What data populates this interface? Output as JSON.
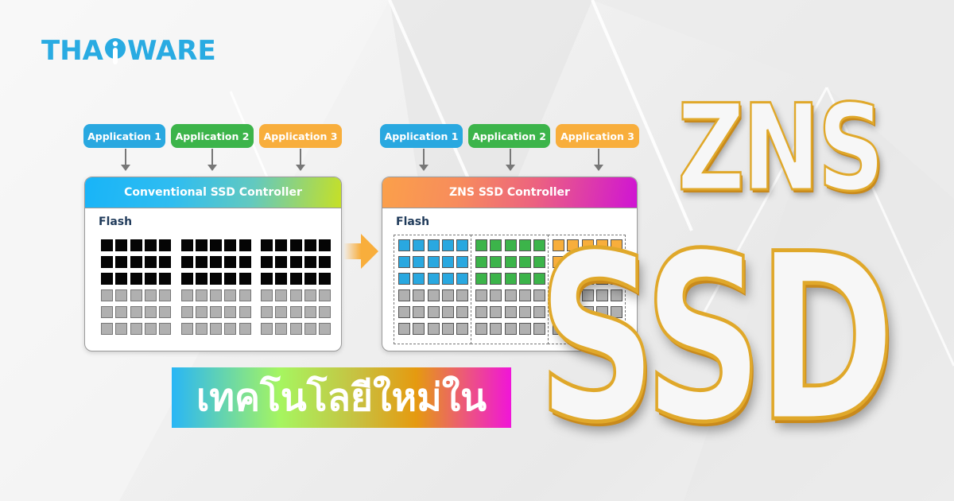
{
  "brand": {
    "logo_text_left": "THA",
    "logo_text_right": "WARE",
    "logo_color": "#29abe2"
  },
  "left_diagram": {
    "apps": [
      {
        "label": "Application 1",
        "color": "#29a8e0"
      },
      {
        "label": "Application 2",
        "color": "#3cb44a"
      },
      {
        "label": "Application 3",
        "color": "#f8ae3c"
      }
    ],
    "controller_title": "Conventional SSD Controller",
    "header_gradient": [
      "#18b4f8",
      "#62c9c0",
      "#c6e026"
    ],
    "flash_label": "Flash",
    "rows": [
      [
        "black",
        "black",
        "black"
      ],
      [
        "black",
        "black",
        "black"
      ],
      [
        "black",
        "black",
        "black"
      ],
      [
        "gray",
        "gray",
        "gray"
      ],
      [
        "gray",
        "gray",
        "gray"
      ],
      [
        "gray",
        "gray",
        "gray"
      ]
    ]
  },
  "transition_arrow": {
    "icon": "arrow-right-icon",
    "color": "#f8ae3c"
  },
  "right_diagram": {
    "apps": [
      {
        "label": "Application 1",
        "color": "#29a8e0"
      },
      {
        "label": "Application 2",
        "color": "#3cb44a"
      },
      {
        "label": "Application 3",
        "color": "#f8ae3c"
      }
    ],
    "controller_title": "ZNS SSD Controller",
    "header_gradient": [
      "#fba04a",
      "#ef6a7a",
      "#cf14d4"
    ],
    "flash_label": "Flash",
    "zones": [
      {
        "used_rows": 3,
        "color": "#29a8e0"
      },
      {
        "used_rows": 3,
        "color": "#3cb44a"
      },
      {
        "used_rows": 3,
        "color": "#f8ae3c"
      }
    ],
    "total_rows": 6
  },
  "cell_colors": {
    "black": "#050505",
    "gray": "#b0b0b0"
  },
  "headline": {
    "thai_text": "เทคโนโลยีใหม่ใน",
    "title_line1": "ZNS",
    "title_line2": "SSD"
  }
}
